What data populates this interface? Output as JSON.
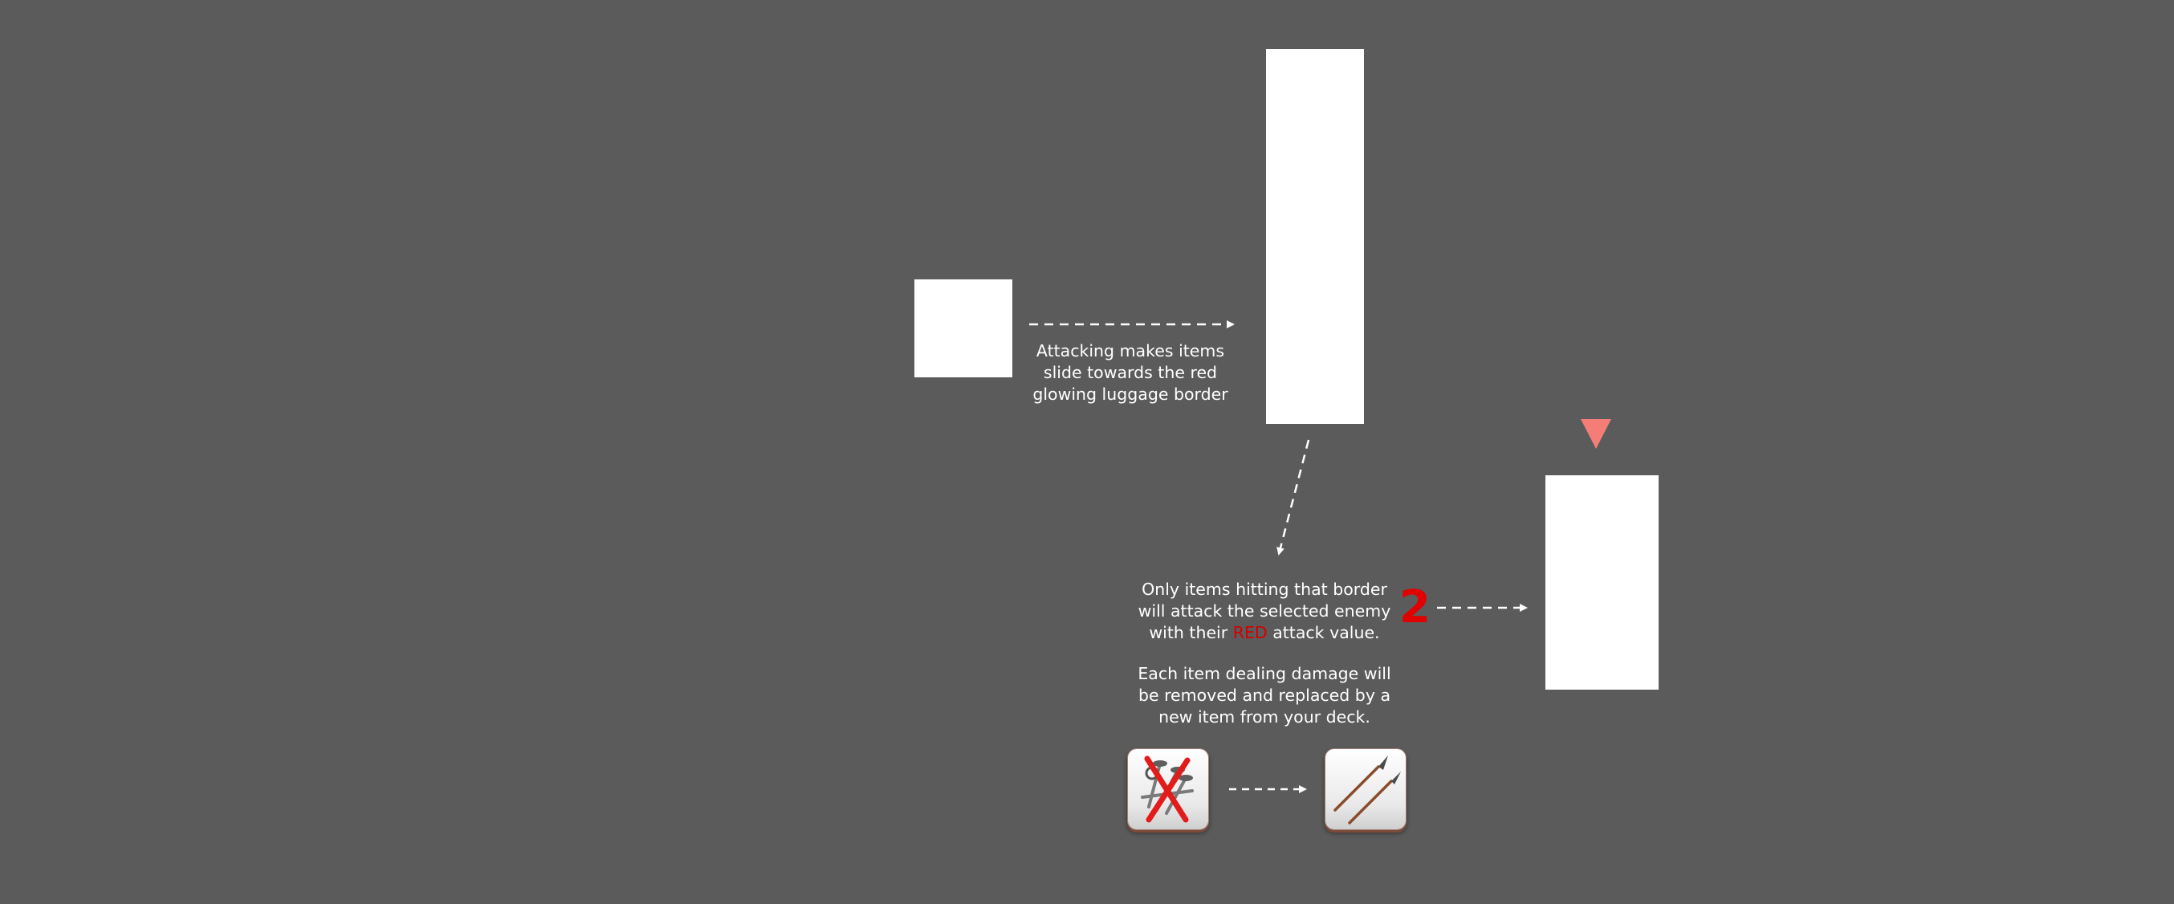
{
  "tutorial": {
    "captions": {
      "attack_slide": [
        "Attacking makes items",
        "slide towards the red",
        "glowing luggage border"
      ],
      "border_attack": {
        "line1": "Only items hitting that border",
        "line2": "will attack the selected enemy",
        "line3_before": "with their ",
        "line3_red": "RED",
        "line3_after": " attack value."
      },
      "replacement": [
        "Each item dealing damage will",
        "be removed and replaced by a",
        "new item from your deck."
      ]
    },
    "damage_value": "2",
    "items": {
      "removed": {
        "icon": "crossed-out-nails-icon"
      },
      "replacement": {
        "icon": "spears-icon"
      }
    },
    "colors": {
      "background": "#5b5b5b",
      "marker": "#f47e77",
      "damage_red": "#e00000"
    }
  }
}
